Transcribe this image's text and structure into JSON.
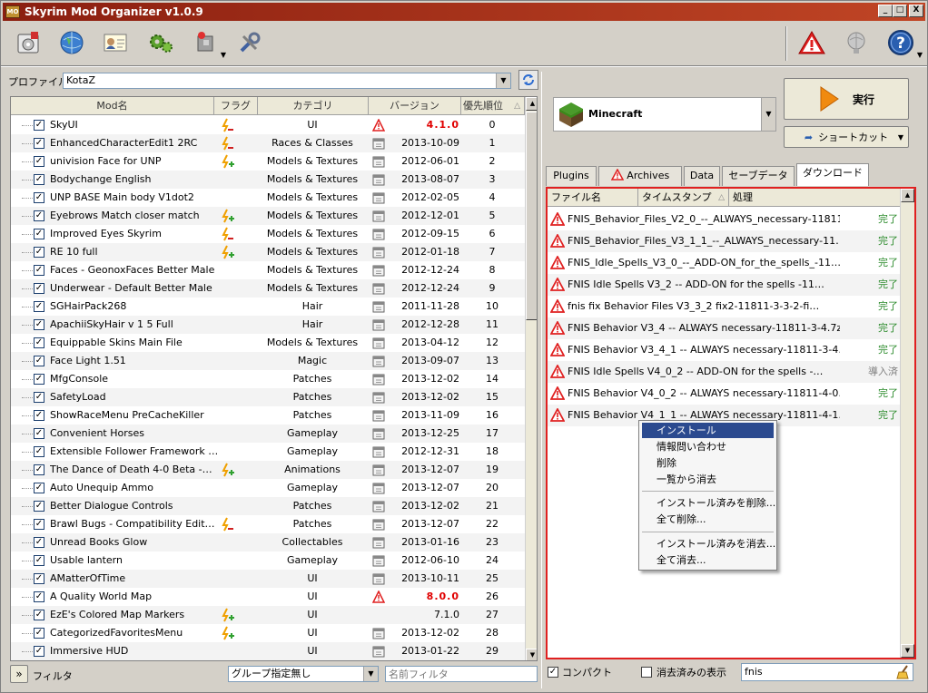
{
  "window": {
    "title": "Skyrim Mod Organizer v1.0.9",
    "icon_label": "MO",
    "minimize": "_",
    "maximize": "□",
    "close": "X"
  },
  "toolbar": {
    "icons": [
      "install-mod-icon",
      "nexus-globe-icon",
      "profiles-icon",
      "executables-gears-icon",
      "tools-puzzle-icon",
      "settings-wrench-icon"
    ],
    "right_icons": [
      "problems-warning-icon",
      "update-globe-icon",
      "help-icon"
    ]
  },
  "profile": {
    "label": "プロファイル",
    "value": "KotaZ"
  },
  "mods": {
    "headers": {
      "name": "Mod名",
      "flags": "フラグ",
      "category": "カテゴリ",
      "version": "バージョン",
      "priority": "優先順位"
    },
    "rows": [
      {
        "name": "SkyUI",
        "flag": "backup",
        "category": "UI",
        "vicon": "warning",
        "version": "4.1.0",
        "red": true,
        "priority": "0"
      },
      {
        "name": "EnhancedCharacterEdit1 2RC",
        "flag": "backup",
        "category": "Races & Classes",
        "vicon": "cal",
        "version": "2013-10-09",
        "priority": "1"
      },
      {
        "name": "univision Face for UNP",
        "flag": "green",
        "category": "Models & Textures",
        "vicon": "cal",
        "version": "2012-06-01",
        "priority": "2"
      },
      {
        "name": "Bodychange English",
        "flag": "",
        "category": "Models & Textures",
        "vicon": "cal",
        "version": "2013-08-07",
        "priority": "3"
      },
      {
        "name": "UNP BASE Main body V1dot2",
        "flag": "",
        "category": "Models & Textures",
        "vicon": "cal",
        "version": "2012-02-05",
        "priority": "4"
      },
      {
        "name": "Eyebrows Match closer match",
        "flag": "green",
        "category": "Models & Textures",
        "vicon": "cal",
        "version": "2012-12-01",
        "priority": "5"
      },
      {
        "name": "Improved Eyes Skyrim",
        "flag": "backup",
        "category": "Models & Textures",
        "vicon": "cal",
        "version": "2012-09-15",
        "priority": "6"
      },
      {
        "name": "RE 10 full",
        "flag": "green",
        "category": "Models & Textures",
        "vicon": "cal",
        "version": "2012-01-18",
        "priority": "7"
      },
      {
        "name": "Faces - GeonoxFaces Better Male",
        "flag": "",
        "category": "Models & Textures",
        "vicon": "cal",
        "version": "2012-12-24",
        "priority": "8"
      },
      {
        "name": "Underwear - Default Better Male",
        "flag": "",
        "category": "Models & Textures",
        "vicon": "cal",
        "version": "2012-12-24",
        "priority": "9"
      },
      {
        "name": "SGHairPack268",
        "flag": "",
        "category": "Hair",
        "vicon": "cal",
        "version": "2011-11-28",
        "priority": "10"
      },
      {
        "name": "ApachiiSkyHair v 1 5 Full",
        "flag": "",
        "category": "Hair",
        "vicon": "cal",
        "version": "2012-12-28",
        "priority": "11"
      },
      {
        "name": "Equippable Skins Main File",
        "flag": "",
        "category": "Models & Textures",
        "vicon": "cal",
        "version": "2013-04-12",
        "priority": "12"
      },
      {
        "name": "Face Light 1.51",
        "flag": "",
        "category": "Magic",
        "vicon": "cal",
        "version": "2013-09-07",
        "priority": "13"
      },
      {
        "name": "MfgConsole",
        "flag": "",
        "category": "Patches",
        "vicon": "cal",
        "version": "2013-12-02",
        "priority": "14"
      },
      {
        "name": "SafetyLoad",
        "flag": "",
        "category": "Patches",
        "vicon": "cal",
        "version": "2013-12-02",
        "priority": "15"
      },
      {
        "name": "ShowRaceMenu PreCacheKiller",
        "flag": "",
        "category": "Patches",
        "vicon": "cal",
        "version": "2013-11-09",
        "priority": "16"
      },
      {
        "name": "Convenient Horses",
        "flag": "",
        "category": "Gameplay",
        "vicon": "cal",
        "version": "2013-12-25",
        "priority": "17"
      },
      {
        "name": "Extensible Follower Framework …",
        "flag": "",
        "category": "Gameplay",
        "vicon": "cal",
        "version": "2012-12-31",
        "priority": "18"
      },
      {
        "name": "The Dance of Death 4-0 Beta -…",
        "flag": "green",
        "category": "Animations",
        "vicon": "cal",
        "version": "2013-12-07",
        "priority": "19"
      },
      {
        "name": "Auto Unequip Ammo",
        "flag": "",
        "category": "Gameplay",
        "vicon": "cal",
        "version": "2013-12-07",
        "priority": "20"
      },
      {
        "name": "Better Dialogue Controls",
        "flag": "",
        "category": "Patches",
        "vicon": "cal",
        "version": "2013-12-02",
        "priority": "21"
      },
      {
        "name": "Brawl Bugs - Compatibility Edit…",
        "flag": "backup",
        "category": "Patches",
        "vicon": "cal",
        "version": "2013-12-07",
        "priority": "22"
      },
      {
        "name": "Unread Books Glow",
        "flag": "",
        "category": "Collectables",
        "vicon": "cal",
        "version": "2013-01-16",
        "priority": "23"
      },
      {
        "name": "Usable lantern",
        "flag": "",
        "category": "Gameplay",
        "vicon": "cal",
        "version": "2012-06-10",
        "priority": "24"
      },
      {
        "name": "AMatterOfTime",
        "flag": "",
        "category": "UI",
        "vicon": "cal",
        "version": "2013-10-11",
        "priority": "25"
      },
      {
        "name": "A Quality World Map",
        "flag": "",
        "category": "UI",
        "vicon": "warning",
        "version": "8.0.0",
        "red": true,
        "priority": "26"
      },
      {
        "name": "EzE's Colored Map Markers",
        "flag": "green",
        "category": "UI",
        "vicon": "",
        "version": "7.1.0",
        "priority": "27"
      },
      {
        "name": "CategorizedFavoritesMenu",
        "flag": "green",
        "category": "UI",
        "vicon": "cal",
        "version": "2013-12-02",
        "priority": "28"
      },
      {
        "name": "Immersive HUD",
        "flag": "",
        "category": "UI",
        "vicon": "cal",
        "version": "2013-01-22",
        "priority": "29"
      }
    ]
  },
  "filter": {
    "toggle": "»",
    "label": "フィルタ",
    "group": "グループ指定無し",
    "name_placeholder": "名前フィルタ"
  },
  "executable": {
    "name": "Minecraft",
    "run": "実行",
    "shortcut": "ショートカット"
  },
  "tabs": {
    "plugins": "Plugins",
    "archives": "Archives",
    "data": "Data",
    "saves": "セーブデータ",
    "downloads": "ダウンロード"
  },
  "downloads": {
    "headers": {
      "file": "ファイル名",
      "time": "タイムスタンプ",
      "status": "処理"
    },
    "rows": [
      {
        "name": "FNIS_Behavior_Files_V2_0_--_ALWAYS_necessary-11811…",
        "status": "完了"
      },
      {
        "name": "FNIS_Behavior_Files_V3_1_1_--_ALWAYS_necessary-11…",
        "status": "完了"
      },
      {
        "name": "FNIS_Idle_Spells_V3_0_--_ADD-ON_for_the_spells_-11…",
        "status": "完了"
      },
      {
        "name": "FNIS Idle Spells V3_2 -- ADD-ON for the spells -11…",
        "status": "完了"
      },
      {
        "name": "fnis fix Behavior Files V3_3_2 fix2-11811-3-3-2-fi…",
        "status": "完了"
      },
      {
        "name": "FNIS Behavior V3_4 -- ALWAYS necessary-11811-3-4.7z",
        "status": "完了"
      },
      {
        "name": "FNIS Behavior V3_4_1 -- ALWAYS necessary-11811-3-4…",
        "status": "完了"
      },
      {
        "name": "FNIS Idle Spells V4_0_2 -- ADD-ON for the spells -…",
        "status": "導入済",
        "gray": true
      },
      {
        "name": "FNIS Behavior V4_0_2 -- ALWAYS necessary-11811-4-0…",
        "status": "完了"
      },
      {
        "name": "FNIS Behavior V4_1_1 -- ALWAYS necessary-11811-4-1…",
        "status": "完了"
      }
    ],
    "compact": "コンパクト",
    "show_hidden": "消去済みの表示",
    "filter_value": "fnis"
  },
  "context_menu": {
    "group1": [
      "インストール",
      "情報問い合わせ",
      "削除",
      "一覧から消去"
    ],
    "group2": [
      "インストール済みを削除...",
      "全て削除..."
    ],
    "group3": [
      "インストール済みを消去...",
      "全て消去..."
    ]
  },
  "colors": {
    "title_start": "#8b1f10",
    "title_end": "#c04525",
    "accent_red": "#e02020",
    "done_green": "#2a8a2a",
    "menu_highlight": "#2b4a8f"
  }
}
